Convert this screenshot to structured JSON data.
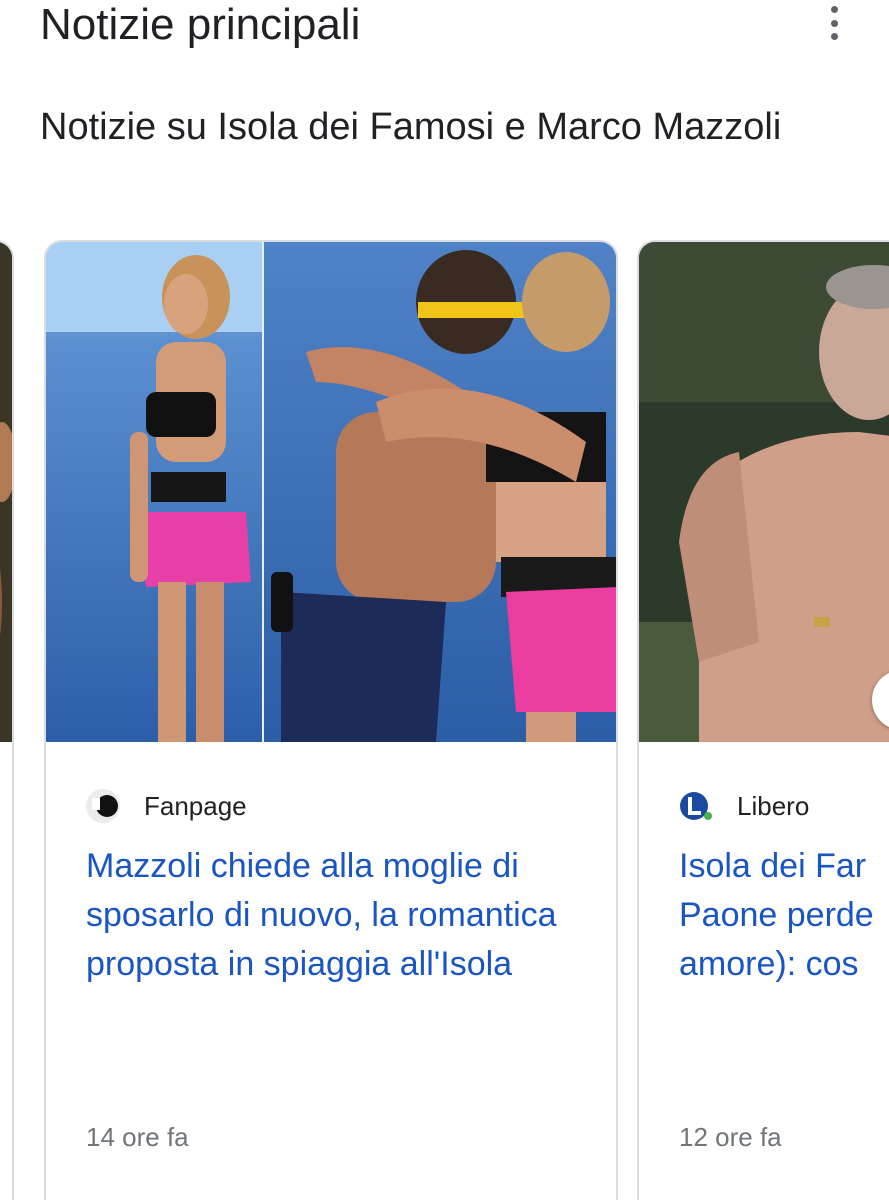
{
  "header": {
    "title": "Notizie principali",
    "menu_icon": "more-vert-icon"
  },
  "topic": {
    "title": "Notizie su Isola dei Famosi e Marco Mazzoli"
  },
  "cards": [
    {
      "source": "Fanpage",
      "source_icon": "fanpage-logo",
      "headline": "Mazzoli chiede alla moglie di sposarlo di nuovo, la romantica proposta in spiaggia all'Isola",
      "time": "14 ore fa"
    },
    {
      "source": "Libero",
      "source_icon": "libero-logo",
      "headline": "Isola dei Far\nPaone perde\namore): cos",
      "time": "12 ore fa"
    }
  ],
  "colors": {
    "headline_link": "#1a55c4",
    "text": "#202124",
    "muted": "#70757a",
    "border": "#dadce0"
  }
}
